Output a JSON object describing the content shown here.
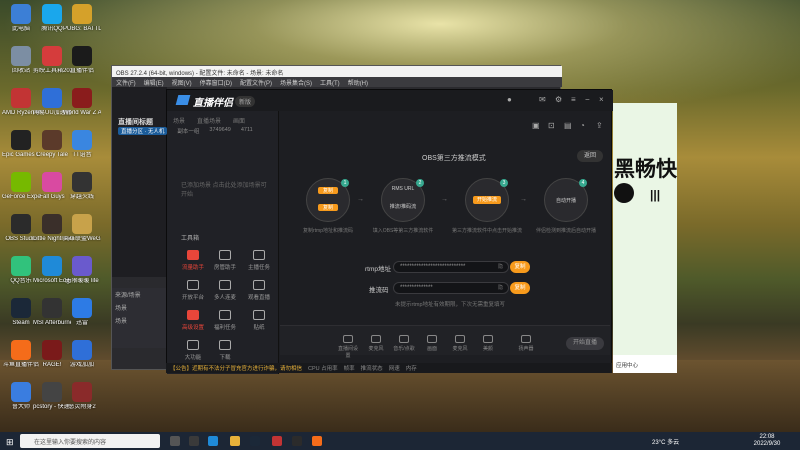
{
  "desktop": {
    "icons": [
      {
        "label": "此电脑",
        "color": "#3c7fd6"
      },
      {
        "label": "腾讯QQ",
        "color": "#1aa7ec"
      },
      {
        "label": "PUBG: BATTLEGR...",
        "color": "#d5a12a"
      },
      {
        "label": "回收站",
        "color": "#7c8ea3"
      },
      {
        "label": "剪映工具箱2022",
        "color": "#d53c3c"
      },
      {
        "label": "直播伴侣",
        "color": "#1b1b1b"
      },
      {
        "label": "AMD Ryzen Master",
        "color": "#c23434"
      },
      {
        "label": "网易UU加速器",
        "color": "#2f6fd8"
      },
      {
        "label": "World War Z Aftermath",
        "color": "#8a1c1c"
      },
      {
        "label": "Epic Games Launcher",
        "color": "#222"
      },
      {
        "label": "Creepy Tale",
        "color": "#5b3a2a"
      },
      {
        "label": "TT语音",
        "color": "#3a86e0"
      },
      {
        "label": "GeForce Experience",
        "color": "#76b900"
      },
      {
        "label": "Fall Guys",
        "color": "#d94aa1"
      },
      {
        "label": "穿越火线",
        "color": "#333"
      },
      {
        "label": "OBS Studio",
        "color": "#2b2b2b"
      },
      {
        "label": "Little Nightmares",
        "color": "#3a2f2a"
      },
      {
        "label": "英雄联盟WeGame",
        "color": "#c8a24a"
      },
      {
        "label": "QQ音乐",
        "color": "#31c27c"
      },
      {
        "label": "Microsoft Edge",
        "color": "#1f8ad8"
      },
      {
        "label": "无限暖暖 lite",
        "color": "#6a5acd"
      },
      {
        "label": "Steam",
        "color": "#1b2838"
      },
      {
        "label": "MSI Afterburner",
        "color": "#333"
      },
      {
        "label": "迅雷",
        "color": "#2d7be5"
      },
      {
        "label": "斗鱼直播伴侣",
        "color": "#f56c1a"
      },
      {
        "label": "RAGE!",
        "color": "#7a1a1a"
      },
      {
        "label": "游戏加加",
        "color": "#2f6fd8"
      },
      {
        "label": "鲁大师",
        "color": "#3a7de0"
      },
      {
        "label": "pcstory - 快速文档",
        "color": "#444"
      },
      {
        "label": "恶灵附身2",
        "color": "#8a2a2a"
      }
    ]
  },
  "obs": {
    "title": "OBS 27.2.4 (64-bit, windows) - 配置文件: 未命名 - 场景: 未命名",
    "menu": [
      "文件(F)",
      "编辑(E)",
      "视图(V)",
      "停靠窗口(D)",
      "配置文件(P)",
      "场景集合(S)",
      "工具(T)",
      "帮助(H)"
    ],
    "panel_header": "来源/场景",
    "panel_rows": [
      "场景",
      "场景"
    ]
  },
  "tool": {
    "app_name": "直播伴侣",
    "version_badge": "新版",
    "tabs": [
      "场景",
      "直播场景",
      "画面"
    ],
    "side_message": "已添加场景 点击此处添加场景可开始",
    "toolbox_label": "工具箱",
    "tools": [
      {
        "label": "流量助手",
        "active": true
      },
      {
        "label": "房管助手",
        "active": false
      },
      {
        "label": "主播任务",
        "active": false
      },
      {
        "label": "开放平台",
        "active": false
      },
      {
        "label": "多人连麦",
        "active": false
      },
      {
        "label": "观看直播",
        "active": false
      },
      {
        "label": "高级设置",
        "active": true
      },
      {
        "label": "福利任务",
        "active": false
      },
      {
        "label": "贴纸",
        "active": false
      },
      {
        "label": "大功能",
        "active": false
      },
      {
        "label": "下载",
        "active": false
      }
    ],
    "room": {
      "title": "直播间标题",
      "tag": "直播分区 · 无人机",
      "meta": [
        "副本一组",
        "3749649",
        "4711"
      ]
    },
    "mode_title": "OBS第三方推流模式",
    "back_label": "返回",
    "steps": [
      {
        "num": "1",
        "btn1": "复制",
        "btn2": "复制",
        "caption": "复制rtmp地址和推流码"
      },
      {
        "num": "2",
        "btn1": "RMS URL",
        "btn2": "推流/推码流",
        "caption": "填入OBS等第三方推流软件"
      },
      {
        "num": "3",
        "btn1": "开始推流",
        "btn2": "",
        "caption": "第三方推流软件中点击开始推流"
      },
      {
        "num": "4",
        "btn1": "自动开播",
        "btn2": "",
        "caption": "伴侣检测到推流后自动开播"
      }
    ],
    "fields": [
      {
        "label": "rtmp地址",
        "value": "****************************",
        "action": "复制",
        "hint_icon": "隐"
      },
      {
        "label": "推流码",
        "value": "**************",
        "action": "复制",
        "hint_icon": "隐"
      }
    ],
    "hint": "未提示rtmp地址有效期限，下次无需重复填写",
    "bottom_items": [
      "直播间设置",
      "麦克风",
      "音乐/点歌",
      "画面",
      "麦克风",
      "美颜",
      "扬声器"
    ],
    "start_label": "开始直播",
    "status": [
      "CPU 占用率",
      "帧率",
      "推流状态",
      "网速",
      "内存"
    ],
    "status_warning": "【公告】近期有不法分子冒充官方进行诈骗，请勿相信"
  },
  "browser": {
    "big_text": "黑畅快",
    "bars": "|||",
    "bottom": "应用中心"
  },
  "taskbar": {
    "search_placeholder": "在这里输入你要搜索的内容",
    "weather": "23°C 多云",
    "time": "22:08",
    "date": "2022/9/30"
  }
}
